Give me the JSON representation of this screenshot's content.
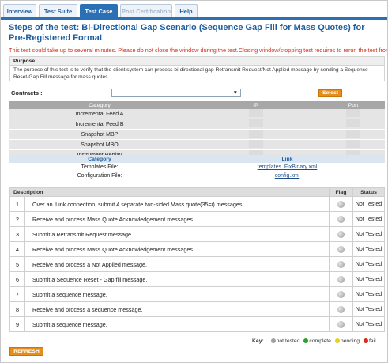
{
  "tabs": [
    {
      "label": "Interview",
      "state": "normal"
    },
    {
      "label": "Test Suite",
      "state": "normal"
    },
    {
      "label": "Test Case",
      "state": "active"
    },
    {
      "label": "Post Certification",
      "state": "disabled"
    },
    {
      "label": "Help",
      "state": "normal"
    }
  ],
  "title": "Steps of the test: Bi-Directional Gap Scenario (Sequence Gap Fill for Mass Quotes) for Pre-Registered Format",
  "warning": "This test could take up to several minutes. Please do not close the window during the test.Closing window/stopping test requires to rerun the test from step1",
  "purpose": {
    "heading": "Purpose",
    "text": "The purpose of this test is to verify that the client system can process bi-directional gap Retransmit Request/Not Applied message by sending a Sequence Reset-Gap Fill message for mass quotes."
  },
  "contracts": {
    "label": "Contracts :",
    "value": "",
    "select_button": "Select"
  },
  "environment": {
    "headers": [
      "Category",
      "IP",
      "Port"
    ],
    "rows": [
      {
        "category": "Incremental Feed A"
      },
      {
        "category": "Incremental Feed B"
      },
      {
        "category": "Snapshot MBP"
      },
      {
        "category": "Snapshot MBO"
      },
      {
        "category": "Instrument Replay"
      }
    ]
  },
  "files": {
    "headers": [
      "Category",
      "Link"
    ],
    "rows": [
      {
        "category": "Templates File:",
        "link": "templates_FixBinary.xml"
      },
      {
        "category": "Configuration File:",
        "link": "config.xml"
      }
    ]
  },
  "steps": {
    "headers": [
      "Description",
      "Flag",
      "Status"
    ],
    "rows": [
      {
        "num": "1",
        "desc": "Over an iLink connection, submit 4 separate two-sided Mass quote(35=i) messages.",
        "status": "Not Tested"
      },
      {
        "num": "2",
        "desc": "Receive and process Mass Quote Acknowledgement messages.",
        "status": "Not Tested"
      },
      {
        "num": "3",
        "desc": "Submit a Retransmit Request message.",
        "status": "Not Tested"
      },
      {
        "num": "4",
        "desc": "Receive and process Mass Quote Acknowledgement messages.",
        "status": "Not Tested"
      },
      {
        "num": "5",
        "desc": "Receive and process a Not Applied message.",
        "status": "Not Tested"
      },
      {
        "num": "6",
        "desc": "Submit a Sequence Reset - Gap fill message.",
        "status": "Not Tested"
      },
      {
        "num": "7",
        "desc": "Submit a sequence message.",
        "status": "Not Tested"
      },
      {
        "num": "8",
        "desc": "Receive and process a sequence message.",
        "status": "Not Tested"
      },
      {
        "num": "9",
        "desc": "Submit a sequence message.",
        "status": "Not Tested"
      }
    ]
  },
  "key": {
    "label": "Key:",
    "items": [
      {
        "label": "not tested",
        "color": "#a0a0a0"
      },
      {
        "label": "complete",
        "color": "#2e9e2e"
      },
      {
        "label": "pending",
        "color": "#e6d21a"
      },
      {
        "label": "fail",
        "color": "#d42a1f"
      }
    ]
  },
  "refresh_button": "REFRESH",
  "colors": {
    "accent": "#2b6fb5",
    "title": "#1f5e9e",
    "warning": "#d0331c",
    "button": "#e58e1b"
  }
}
